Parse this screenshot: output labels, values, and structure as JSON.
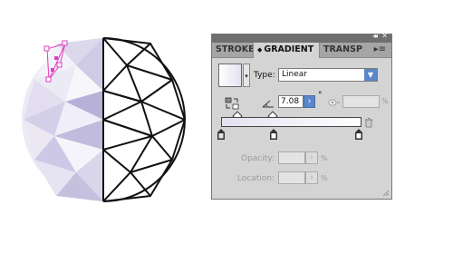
{
  "panel": {
    "tabs": [
      {
        "label": "STROKE",
        "active": false
      },
      {
        "label": "GRADIENT",
        "active": true
      },
      {
        "label": "TRANSP",
        "active": false
      }
    ],
    "collapse_glyph": "◂◂",
    "close_glyph": "✕",
    "menu_icon": "panel-menu-icon",
    "type_label": "Type:",
    "type_value": "Linear",
    "angle_value": "7.08",
    "degree_symbol": "°",
    "aspect_pct": "%",
    "opacity_label": "Opacity:",
    "opacity_pct": "%",
    "location_label": "Location:",
    "location_pct": "%",
    "gradient_colors": {
      "start": "#e4e1f0",
      "end": "#ffffff"
    }
  },
  "colors": {
    "panel_bg": "#d4d4d4",
    "accent": "#5a87c8",
    "selection": "#e040c0",
    "facet_light": "#d8d3ea",
    "facet_dark": "#b3aed4"
  }
}
